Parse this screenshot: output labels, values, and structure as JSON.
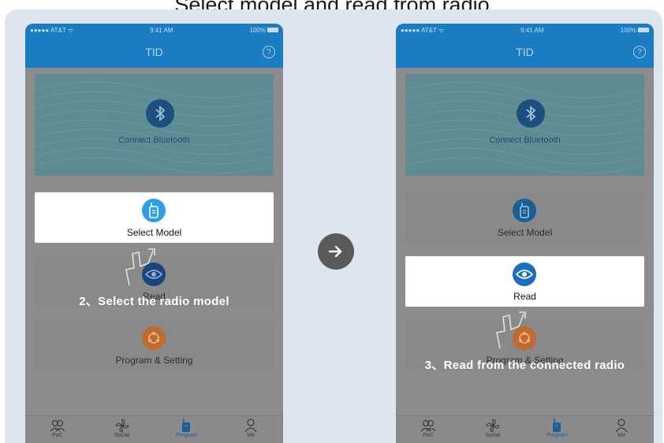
{
  "title": "Select model and read from radio",
  "colors": {
    "accent": "#1a7cc2",
    "dim_overlay": "#8c8c8c",
    "backdrop": "#dde6ee",
    "program_orange": "#c06a2c"
  },
  "screens": [
    {
      "status": {
        "carrier": "●●●●● AT&T ᯤ",
        "time": "9:41 AM",
        "battery": "100%"
      },
      "nav_title": "TID",
      "bluetooth_label": "Connect Bluetooth",
      "cards": [
        {
          "label": "Select Model",
          "icon": "radio-device-icon"
        },
        {
          "label": "Read",
          "icon": "eye-icon"
        },
        {
          "label": "Program & Setting",
          "icon": "program-icon"
        }
      ],
      "active_card": "Select Model",
      "caption": "2、Select the radio model",
      "tabs": [
        "PoC",
        "Social",
        "Program",
        "Me"
      ],
      "active_tab": "Program"
    },
    {
      "status": {
        "carrier": "●●●●● AT&T ᯤ",
        "time": "9:41 AM",
        "battery": "100%"
      },
      "nav_title": "TID",
      "bluetooth_label": "Connect Bluetooth",
      "cards": [
        {
          "label": "Select Model",
          "icon": "radio-device-icon"
        },
        {
          "label": "Read",
          "icon": "eye-icon"
        },
        {
          "label": "Program & Setting",
          "icon": "program-icon"
        }
      ],
      "active_card": "Read",
      "caption": "3、Read from the connected radio",
      "tabs": [
        "PoC",
        "Social",
        "Program",
        "Me"
      ],
      "active_tab": "Program"
    }
  ],
  "next_icon": "arrow-right-icon"
}
